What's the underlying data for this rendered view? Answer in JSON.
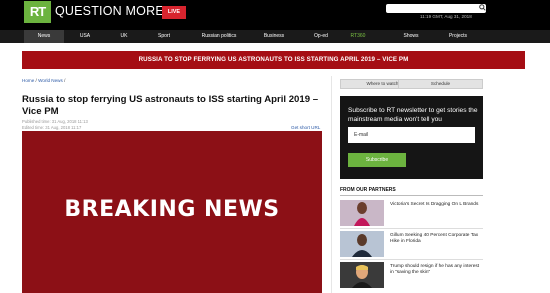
{
  "header": {
    "logo_text": "RT",
    "brand": "QUESTION MORE",
    "live_label": "LIVE",
    "search_placeholder": "",
    "timestamp": "11:19 GMT, Aug 31, 2018",
    "logo_color": "#6cb33f",
    "live_color": "#d7242e"
  },
  "nav": {
    "items": [
      "News",
      "USA",
      "UK",
      "Sport",
      "Russian politics",
      "Business",
      "Op-ed",
      "RT360",
      "Shows",
      "Projects"
    ],
    "active": "News"
  },
  "banner": {
    "text": "RUSSIA TO STOP FERRYING US ASTRONAUTS TO ISS STARTING APRIL 2019 – VICE PM",
    "color": "#a50e14"
  },
  "article": {
    "breadcrumb_home": "Home",
    "breadcrumb_sep": " / ",
    "breadcrumb_section": "World News",
    "breadcrumb_end": " /",
    "title": "Russia to stop ferrying US astronauts to ISS starting April 2019 – Vice PM",
    "published": "Published time: 31 Aug, 2018 11:13",
    "edited": "Edited time: 31 Aug, 2018 11:17",
    "short_url": "Get short URL",
    "hero_text": "BREAKING NEWS"
  },
  "sidebar": {
    "tabs": [
      "Where to watch",
      "Schedule"
    ],
    "newsletter": {
      "text": "Subscribe to RT newsletter to get stories the mainstream media won't tell you",
      "email_placeholder": "E-mail",
      "subscribe_label": "Subscribe"
    },
    "partners_heading": "FROM OUR PARTNERS",
    "partners": [
      {
        "text": "Victoria's Secret Is Dragging On L Brands"
      },
      {
        "text": "Gillum Seeking 40 Percent Corporate Tax Hike in Florida"
      },
      {
        "text": "Trump should resign if he has any interest in \"saving the skin\""
      }
    ]
  }
}
